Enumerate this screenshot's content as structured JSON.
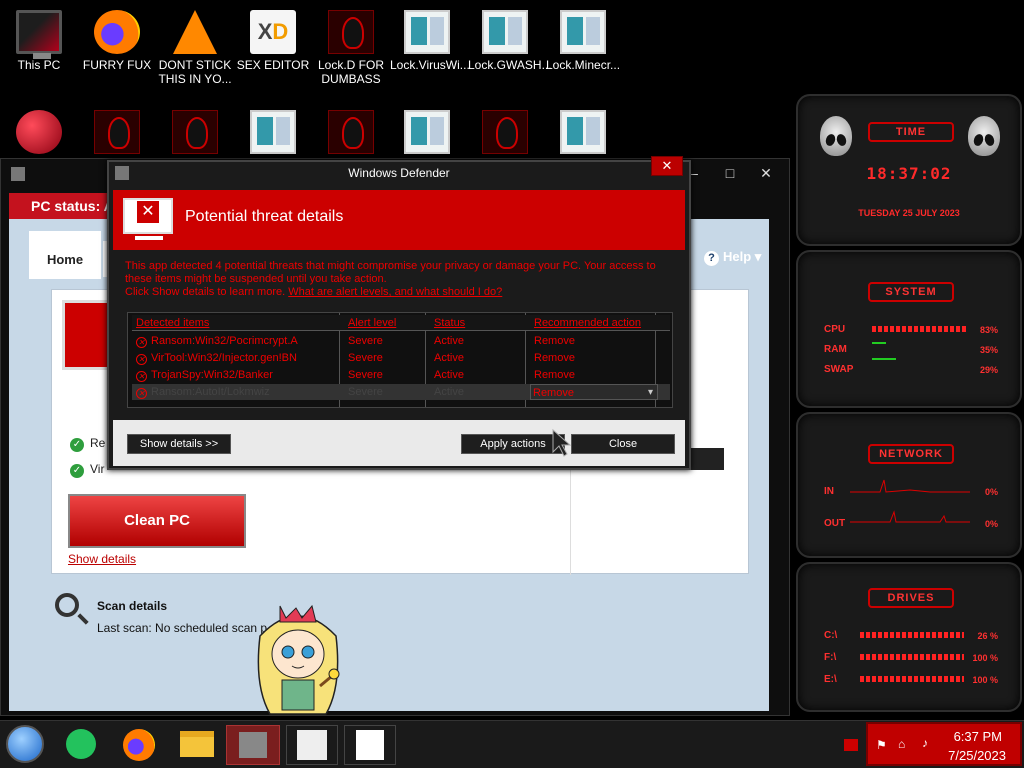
{
  "desktop_icons_row1": [
    {
      "label": "This PC",
      "icon": "monitor-icon"
    },
    {
      "label": "FURRY FUX",
      "icon": "firefox-icon"
    },
    {
      "label": "DONT STICK THIS IN YO...",
      "icon": "vlc-icon"
    },
    {
      "label": "SEX EDITOR",
      "icon": "hxd-icon"
    },
    {
      "label": "Lock.D FOR DUMBASS",
      "icon": "alien-lock-icon"
    },
    {
      "label": "Lock.VirusWi...",
      "icon": "window-icon"
    },
    {
      "label": "Lock.GWASH...",
      "icon": "window-icon"
    },
    {
      "label": "Lock.Minecr...",
      "icon": "window-icon"
    }
  ],
  "background_window": {
    "status_text": "PC status: A",
    "tab_home": "Home",
    "help": "Help",
    "checks": [
      "Re",
      "Vir"
    ],
    "clean_button": "Clean PC",
    "show_details": "Show details",
    "scan_title": "Scan details",
    "last_scan": "Last scan:  No scheduled scan p"
  },
  "modal": {
    "title": "Windows Defender",
    "close": "✕",
    "banner_title": "Potential threat details",
    "message_1": "This app detected 4 potential threats that might compromise your privacy or damage your PC. Your access to these items might be suspended until you take action.",
    "message_2": "Click Show details to learn more.",
    "link": "What are alert levels, and what should I do?",
    "columns": [
      "Detected items",
      "Alert level",
      "Status",
      "Recommended action"
    ],
    "rows": [
      {
        "item": "Ransom:Win32/Pocrimcrypt.A",
        "level": "Severe",
        "status": "Active",
        "action": "Remove"
      },
      {
        "item": "VirTool:Win32/Injector.gen!BN",
        "level": "Severe",
        "status": "Active",
        "action": "Remove"
      },
      {
        "item": "TrojanSpy:Win32/Banker",
        "level": "Severe",
        "status": "Active",
        "action": "Remove"
      },
      {
        "item": "Ransom:AutoIt/Lokmwiz",
        "level": "Severe",
        "status": "Active",
        "action": "Remove"
      }
    ],
    "show_details_button": "Show details >>",
    "apply_button": "Apply actions",
    "close_button": "Close"
  },
  "gadgets": {
    "time": {
      "title": "TIME",
      "clock": "18:37:02",
      "date": "TUESDAY 25 JULY 2023"
    },
    "system": {
      "title": "SYSTEM",
      "cpu_label": "CPU",
      "cpu": "83%",
      "ram_label": "RAM",
      "ram": "35%",
      "swap_label": "SWAP",
      "swap": "29%"
    },
    "network": {
      "title": "NETWORK",
      "in_label": "IN",
      "in": "0%",
      "out_label": "OUT",
      "out": "0%"
    },
    "drives": {
      "title": "DRIVES",
      "rows": [
        {
          "label": "C:\\",
          "value": "26 %"
        },
        {
          "label": "F:\\",
          "value": "100 %"
        },
        {
          "label": "E:\\",
          "value": "100 %"
        }
      ]
    }
  },
  "taskbar": {
    "time": "6:37 PM",
    "date": "7/25/2023"
  }
}
